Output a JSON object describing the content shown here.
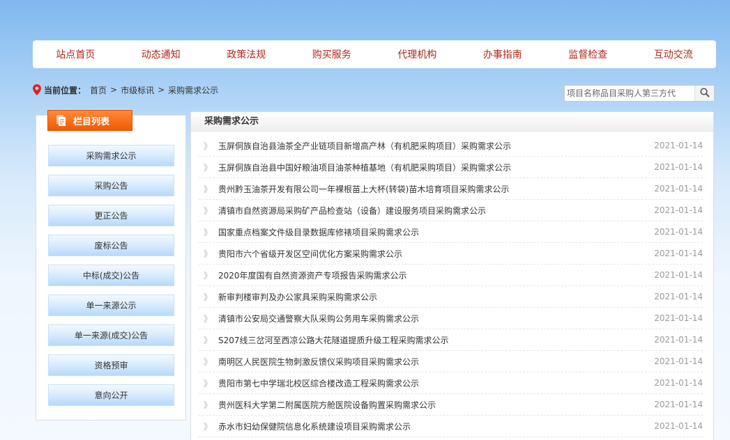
{
  "nav": {
    "items": [
      "站点首页",
      "动态通知",
      "政策法规",
      "购买服务",
      "代理机构",
      "办事指南",
      "监督检查",
      "互动交流"
    ]
  },
  "breadcrumb": {
    "label": "当前位置：",
    "items": [
      "首页",
      "市级标讯",
      "采购需求公示"
    ],
    "separator": ">"
  },
  "search": {
    "placeholder": "项目名称品目采购人第三方代"
  },
  "sidebar": {
    "header": "栏目列表",
    "items": [
      "采购需求公示",
      "采购公告",
      "更正公告",
      "废标公告",
      "中标(成交)公告",
      "单一来源公示",
      "单一来源(成交)公告",
      "资格预审",
      "意向公开"
    ]
  },
  "main": {
    "title": "采购需求公示",
    "rows": [
      {
        "title": "玉屏侗族自治县油茶全产业链项目新增高产林（有机肥采购项目）采购需求公示",
        "date": "2021-01-14"
      },
      {
        "title": "玉屏侗族自治县中国好粮油项目油茶种植基地（有机肥采购项目）采购需求公示",
        "date": "2021-01-14"
      },
      {
        "title": "贵州黔玉油茶开发有限公司一年裸根苗上大杯(转袋)苗木培育项目采购需求公示",
        "date": "2021-01-14"
      },
      {
        "title": "清镇市自然资源局采购矿产品检查站（设备）建设服务项目采购需求公示",
        "date": "2021-01-14"
      },
      {
        "title": "国家重点档案文件级目录数据库修裱项目采购需求公示",
        "date": "2021-01-14"
      },
      {
        "title": "贵阳市六个省级开发区空间优化方案采购需求公示",
        "date": "2021-01-14"
      },
      {
        "title": "2020年度国有自然资源资产专项报告采购需求公示",
        "date": "2021-01-14"
      },
      {
        "title": "新审判楼审判及办公家具采购采购需求公示",
        "date": "2021-01-14"
      },
      {
        "title": "清镇市公安局交通警察大队采购公务用车采购需求公示",
        "date": "2021-01-14"
      },
      {
        "title": "S207线三岔河至西凉公路大花隧道提质升级工程采购需求公示",
        "date": "2021-01-14"
      },
      {
        "title": "南明区人民医院生物刺激反馈仪采购项目采购需求公示",
        "date": "2021-01-14"
      },
      {
        "title": "贵阳市第七中学瑞北校区综合楼改造工程采购需求公示",
        "date": "2021-01-14"
      },
      {
        "title": "贵州医科大学第二附属医院方舱医院设备购置采购需求公示",
        "date": "2021-01-14"
      },
      {
        "title": "赤水市妇幼保健院信息化系统建设项目采购需求公示",
        "date": "2021-01-14"
      }
    ]
  },
  "colors": {
    "nav_text": "#b0281c",
    "sidebar_header": "#f05a00",
    "date_text": "#9a9a9a"
  },
  "icons": {
    "location": "map-pin-icon",
    "search": "magnifier-icon",
    "list": "list-icon",
    "row": "double-chevron-right-icon"
  }
}
